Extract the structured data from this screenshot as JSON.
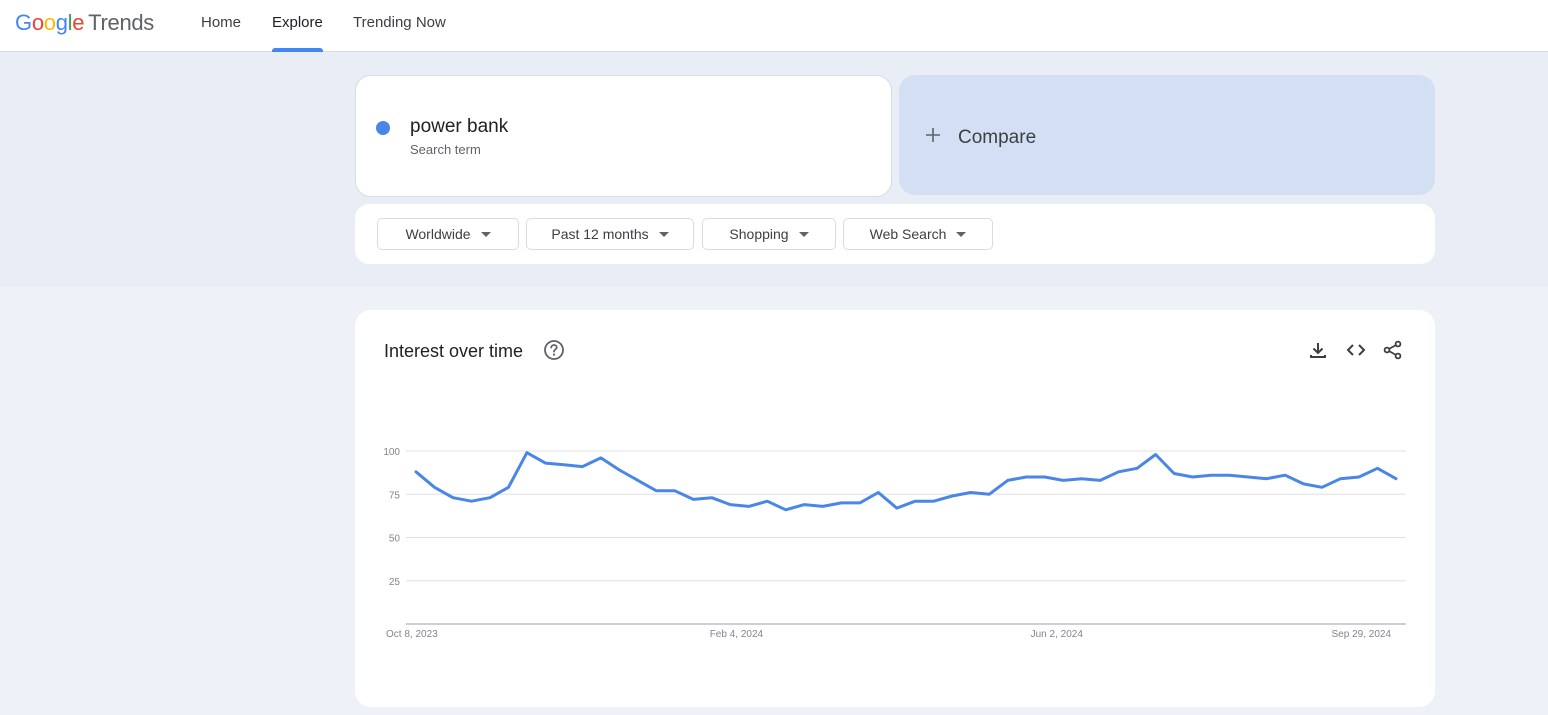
{
  "header": {
    "logo": {
      "g1": "G",
      "g2": "o",
      "g3": "o",
      "g4": "g",
      "g5": "l",
      "g6": "e",
      "product": "Trends"
    },
    "nav": [
      {
        "label": "Home",
        "active": false
      },
      {
        "label": "Explore",
        "active": true
      },
      {
        "label": "Trending Now",
        "active": false
      }
    ]
  },
  "search": {
    "term": "power bank",
    "term_type": "Search term",
    "term_color": "#4a86e8",
    "compare_label": "Compare",
    "compare_icon": "plus-icon"
  },
  "filters": [
    {
      "label": "Worldwide"
    },
    {
      "label": "Past 12 months"
    },
    {
      "label": "Shopping"
    },
    {
      "label": "Web Search"
    }
  ],
  "chart_section": {
    "title": "Interest over time",
    "icons": [
      "help-icon",
      "download-icon",
      "embed-code-icon",
      "share-icon"
    ]
  },
  "chart_data": {
    "type": "line",
    "title": "",
    "xlabel": "",
    "ylabel": "",
    "ylim": [
      0,
      100
    ],
    "y_ticks": [
      25,
      50,
      75,
      100
    ],
    "x_tick_labels": [
      "Oct 8, 2023",
      "Feb 4, 2024",
      "Jun 2, 2024",
      "Sep 29, 2024"
    ],
    "x": [
      "2023-10-08",
      "2023-10-15",
      "2023-10-22",
      "2023-10-29",
      "2023-11-05",
      "2023-11-12",
      "2023-11-19",
      "2023-11-26",
      "2023-12-03",
      "2023-12-10",
      "2023-12-17",
      "2023-12-24",
      "2023-12-31",
      "2024-01-07",
      "2024-01-14",
      "2024-01-21",
      "2024-01-28",
      "2024-02-04",
      "2024-02-11",
      "2024-02-18",
      "2024-02-25",
      "2024-03-03",
      "2024-03-10",
      "2024-03-17",
      "2024-03-24",
      "2024-03-31",
      "2024-04-07",
      "2024-04-14",
      "2024-04-21",
      "2024-04-28",
      "2024-05-05",
      "2024-05-12",
      "2024-05-19",
      "2024-05-26",
      "2024-06-02",
      "2024-06-09",
      "2024-06-16",
      "2024-06-23",
      "2024-06-30",
      "2024-07-07",
      "2024-07-14",
      "2024-07-21",
      "2024-07-28",
      "2024-08-04",
      "2024-08-11",
      "2024-08-18",
      "2024-08-25",
      "2024-09-01",
      "2024-09-08",
      "2024-09-15",
      "2024-09-22",
      "2024-09-29",
      "2024-10-06"
    ],
    "series": [
      {
        "color": "#4a86e8",
        "values": [
          88,
          79,
          73,
          71,
          73,
          79,
          99,
          93,
          92,
          91,
          96,
          89,
          83,
          77,
          77,
          72,
          73,
          69,
          68,
          71,
          66,
          69,
          68,
          70,
          70,
          76,
          67,
          71,
          71,
          74,
          76,
          75,
          83,
          85,
          85,
          83,
          84,
          83,
          88,
          90,
          98,
          87,
          85,
          86,
          86,
          85,
          84,
          86,
          81,
          79,
          84,
          85,
          90,
          84
        ]
      }
    ],
    "grid": true,
    "gridline_color": "#e0e0e0"
  }
}
